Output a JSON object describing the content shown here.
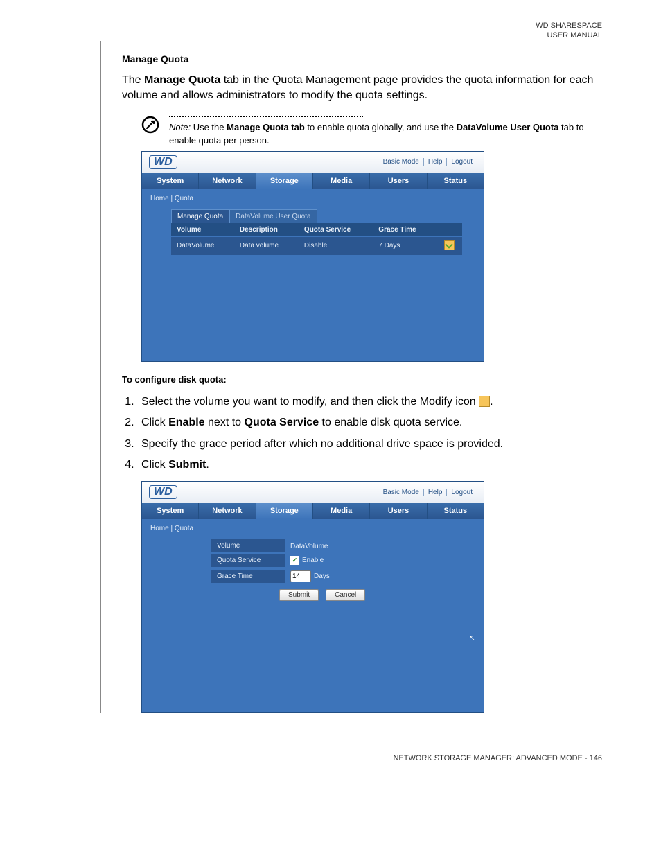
{
  "header": {
    "line1": "WD SHARESPACE",
    "line2": "USER MANUAL"
  },
  "section_title": "Manage Quota",
  "intro_parts": {
    "p1_a": "The ",
    "p1_b": "Manage Quota",
    "p1_c": " tab in the Quota Management page provides the quota information for each volume and allows administrators to modify the quota settings."
  },
  "note": {
    "label": "Note:",
    "a": " Use the ",
    "b": "Manage Quota tab",
    "c": " to enable quota globally, and use the ",
    "d": "DataVolume User Quota",
    "e": " tab to enable quota per person."
  },
  "ui": {
    "logo": "WD",
    "toplinks": {
      "basic": "Basic Mode",
      "help": "Help",
      "logout": "Logout"
    },
    "nav": {
      "system": "System",
      "network": "Network",
      "storage": "Storage",
      "media": "Media",
      "users": "Users",
      "status": "Status"
    },
    "crumb": "Home | Quota",
    "tabs": {
      "mq": "Manage Quota",
      "dv": "DataVolume User Quota"
    },
    "table": {
      "h_volume": "Volume",
      "h_desc": "Description",
      "h_qs": "Quota Service",
      "h_gt": "Grace Time",
      "r_volume": "DataVolume",
      "r_desc": "Data volume",
      "r_qs": "Disable",
      "r_gt": "7 Days"
    },
    "form": {
      "l_volume": "Volume",
      "v_volume": "DataVolume",
      "l_qs": "Quota Service",
      "v_enable": "Enable",
      "l_gt": "Grace Time",
      "v_gt": "14",
      "v_days": "Days",
      "submit": "Submit",
      "cancel": "Cancel"
    }
  },
  "configure_heading": "To configure disk quota:",
  "steps": {
    "s1": "Select the volume you want to modify, and then click the Modify icon ",
    "s1b": ".",
    "s2a": "Click ",
    "s2b": "Enable",
    "s2c": " next to ",
    "s2d": "Quota Service",
    "s2e": " to enable disk quota service.",
    "s3": "Specify the grace period after which no additional drive space is provided.",
    "s4a": "Click ",
    "s4b": "Submit",
    "s4c": "."
  },
  "footer": "NETWORK STORAGE MANAGER: ADVANCED MODE - 146"
}
